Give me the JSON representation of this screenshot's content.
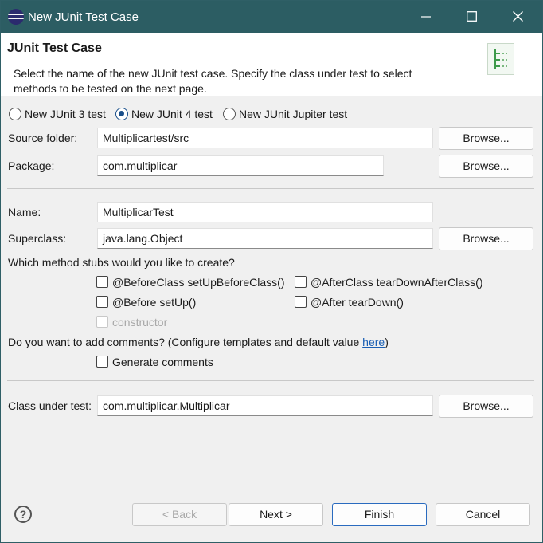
{
  "window": {
    "title": "New JUnit Test Case",
    "controls": {
      "minimize": "minimize",
      "maximize": "maximize",
      "close": "close"
    }
  },
  "header": {
    "title": "JUnit Test Case",
    "description": "Select the name of the new JUnit test case. Specify the class under test to select methods to be tested on the next page."
  },
  "junit_version": {
    "options": [
      "New JUnit 3 test",
      "New JUnit 4 test",
      "New JUnit Jupiter test"
    ],
    "selected": "New JUnit 4 test"
  },
  "form": {
    "source_folder": {
      "label": "Source folder:",
      "value": "Multiplicartest/src",
      "browse": "Browse..."
    },
    "package": {
      "label": "Package:",
      "value": "com.multiplicar",
      "browse": "Browse..."
    },
    "name": {
      "label": "Name:",
      "value": "MultiplicarTest"
    },
    "superclass": {
      "label": "Superclass:",
      "value": "java.lang.Object",
      "browse": "Browse..."
    }
  },
  "stubs": {
    "question": "Which method stubs would you like to create?",
    "before_class": "@BeforeClass setUpBeforeClass()",
    "after_class": "@AfterClass tearDownAfterClass()",
    "before": "@Before setUp()",
    "after": "@After tearDown()",
    "constructor": "constructor"
  },
  "comments": {
    "question_prefix": "Do you want to add comments? (Configure templates and default value ",
    "link": "here",
    "question_suffix": ")",
    "generate": "Generate comments"
  },
  "class_under_test": {
    "label": "Class under test:",
    "value": "com.multiplicar.Multiplicar",
    "browse": "Browse..."
  },
  "footer": {
    "help": "?",
    "back": "< Back",
    "next": "Next >",
    "finish": "Finish",
    "cancel": "Cancel"
  }
}
